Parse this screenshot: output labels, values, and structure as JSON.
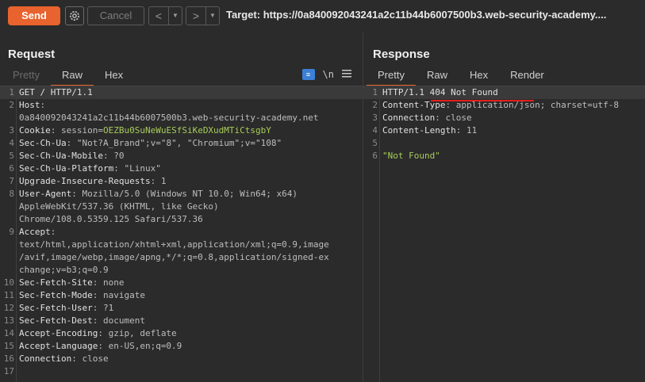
{
  "toolbar": {
    "send_label": "Send",
    "cancel_label": "Cancel",
    "back_symbol": "<",
    "forward_symbol": ">",
    "dropdown_symbol": "▼",
    "target": "Target: https://0a840092043241a2c11b44b6007500b3.web-security-academy...."
  },
  "request": {
    "title": "Request",
    "tabs": [
      "Pretty",
      "Raw",
      "Hex"
    ],
    "active_tab": "Raw",
    "icon_newline": "\\n",
    "lines": [
      {
        "n": "1",
        "k": "GET / HTTP/1.1",
        "v": ""
      },
      {
        "n": "2",
        "k": "Host",
        "v": ":"
      },
      {
        "n": "",
        "k": "",
        "v": "0a840092043241a2c11b44b6007500b3.web-security-academy.net"
      },
      {
        "n": "3",
        "k": "Cookie",
        "v": ": session=",
        "c": "OEZBu0SuNeWuESfSiKeDXudMTiCtsgbY"
      },
      {
        "n": "4",
        "k": "Sec-Ch-Ua",
        "v": ": \"Not?A_Brand\";v=\"8\", \"Chromium\";v=\"108\""
      },
      {
        "n": "5",
        "k": "Sec-Ch-Ua-Mobile",
        "v": ": ?0"
      },
      {
        "n": "6",
        "k": "Sec-Ch-Ua-Platform",
        "v": ": \"Linux\""
      },
      {
        "n": "7",
        "k": "Upgrade-Insecure-Requests",
        "v": ": 1"
      },
      {
        "n": "8",
        "k": "User-Agent",
        "v": ": Mozilla/5.0 (Windows NT 10.0; Win64; x64)"
      },
      {
        "n": "",
        "k": "",
        "v": "AppleWebKit/537.36 (KHTML, like Gecko)"
      },
      {
        "n": "",
        "k": "",
        "v": "Chrome/108.0.5359.125 Safari/537.36"
      },
      {
        "n": "9",
        "k": "Accept",
        "v": ":"
      },
      {
        "n": "",
        "k": "",
        "v": "text/html,application/xhtml+xml,application/xml;q=0.9,image"
      },
      {
        "n": "",
        "k": "",
        "v": "/avif,image/webp,image/apng,*/*;q=0.8,application/signed-ex"
      },
      {
        "n": "",
        "k": "",
        "v": "change;v=b3;q=0.9"
      },
      {
        "n": "10",
        "k": "Sec-Fetch-Site",
        "v": ": none"
      },
      {
        "n": "11",
        "k": "Sec-Fetch-Mode",
        "v": ": navigate"
      },
      {
        "n": "12",
        "k": "Sec-Fetch-User",
        "v": ": ?1"
      },
      {
        "n": "13",
        "k": "Sec-Fetch-Dest",
        "v": ": document"
      },
      {
        "n": "14",
        "k": "Accept-Encoding",
        "v": ": gzip, deflate"
      },
      {
        "n": "15",
        "k": "Accept-Language",
        "v": ": en-US,en;q=0.9"
      },
      {
        "n": "16",
        "k": "Connection",
        "v": ": close"
      },
      {
        "n": "17",
        "k": "",
        "v": ""
      }
    ]
  },
  "response": {
    "title": "Response",
    "tabs": [
      "Pretty",
      "Raw",
      "Hex",
      "Render"
    ],
    "active_tab": "Pretty",
    "lines": [
      {
        "n": "1",
        "k": "HTTP/1.1 404 Not Found",
        "v": ""
      },
      {
        "n": "2",
        "k": "Content-Type",
        "v": ": application/json; charset=utf-8"
      },
      {
        "n": "3",
        "k": "Connection",
        "v": ": close"
      },
      {
        "n": "4",
        "k": "Content-Length",
        "v": ": 11"
      },
      {
        "n": "5",
        "k": "",
        "v": ""
      },
      {
        "n": "6",
        "k": "",
        "v": "",
        "s": "\"Not Found\""
      }
    ]
  },
  "colors": {
    "accent": "#e8632d",
    "cookie": "#a8cc5a",
    "underline": "#e41e1e",
    "pretty_icon": "#3c7fd6"
  }
}
